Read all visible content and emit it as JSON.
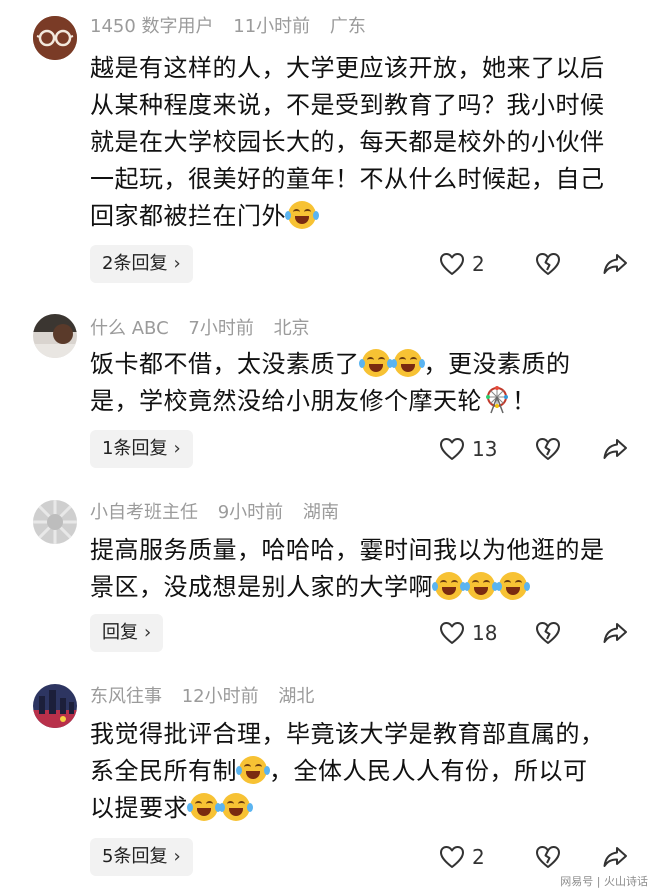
{
  "comments": [
    {
      "username": "1450 数字用户",
      "time": "11小时前",
      "location": "广东",
      "lines": [
        "越是有这样的人，大学更应该开放，她来了以后",
        "从某种程度来说，不是受到教育了吗？我小时候",
        "就是在大学校园长大的，每天都是校外的小伙伴",
        "一起玩，很美好的童年！不从什么时候起，自己",
        "回家都被拦在门外"
      ],
      "replies_label": "2条回复",
      "likes": "2"
    },
    {
      "username": "什么 ABC",
      "time": "7小时前",
      "location": "北京",
      "lines": [
        "饭卡都不借，太没素质了",
        "，更没素质的",
        "是，学校竟然没给小朋友修个摩天轮",
        "！"
      ],
      "replies_label": "1条回复",
      "likes": "13"
    },
    {
      "username": "小自考班主任",
      "time": "9小时前",
      "location": "湖南",
      "lines": [
        "提高服务质量，哈哈哈，霎时间我以为他逛的是",
        "景区，没成想是别人家的大学啊"
      ],
      "replies_label": "回复",
      "likes": "18"
    },
    {
      "username": "东风往事",
      "time": "12小时前",
      "location": "湖北",
      "lines": [
        "我觉得批评合理，毕竟该大学是教育部直属的，",
        "系全民所有制",
        "，全体人民人人有份，所以可",
        "以提要求"
      ],
      "replies_label": "5条回复",
      "likes": "2"
    }
  ],
  "icons": {
    "like": "heart-outline-icon",
    "dislike": "broken-heart-icon",
    "share": "share-arrow-icon",
    "emoji": "laughing-tears-emoji",
    "ferris_wheel": "ferris-wheel-emoji"
  },
  "watermark": "网易号 | 火山诗话",
  "colors": {
    "meta": "#9b9b9b",
    "text": "#111111",
    "pill_bg": "#f2f2f2"
  }
}
